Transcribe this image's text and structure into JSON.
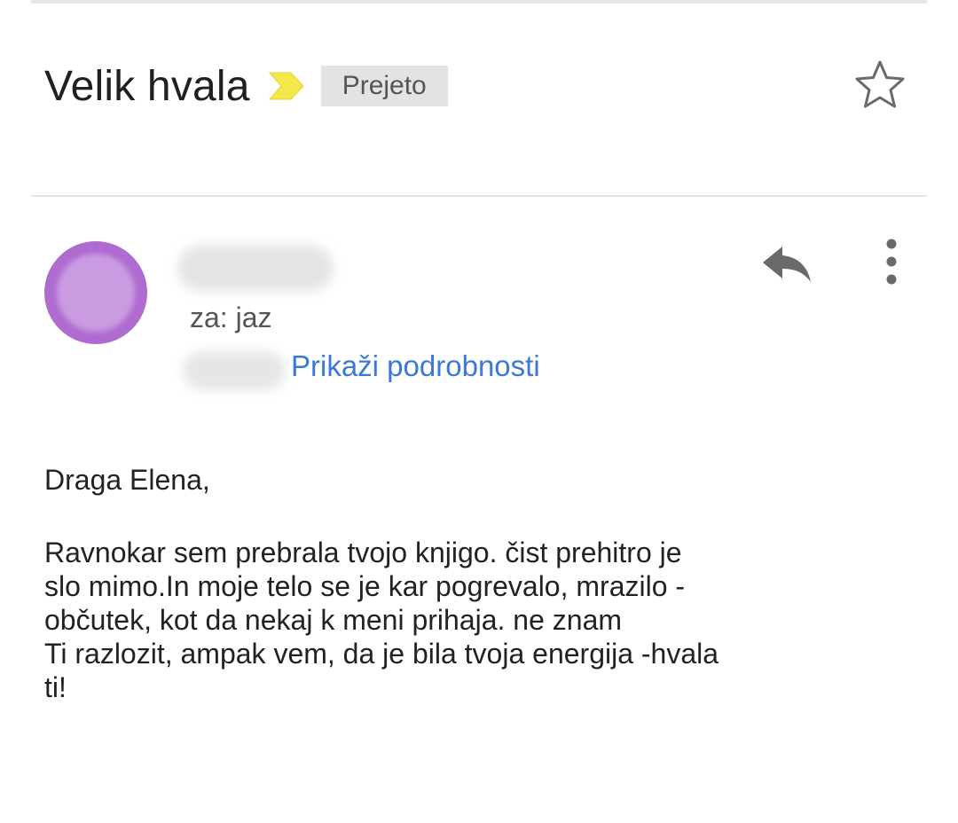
{
  "email": {
    "subject": "Velik hvala",
    "label": "Prejeto",
    "recipient": "za: jaz",
    "show_details": "Prikaži podrobnosti"
  },
  "body": {
    "greeting": "Draga Elena,",
    "lines": [
      "Ravnokar sem prebrala tvojo knjigo. čist prehitro je",
      "slo mimo.In moje telo se je kar pogrevalo, mrazilo -",
      "občutek, kot da nekaj k meni prihaja. ne znam",
      "Ti razlozit, ampak vem, da je bila tvoja energija -hvala",
      "ti!"
    ]
  },
  "icons": {
    "importance": "importance-marker-icon",
    "star": "star-outline-icon",
    "reply": "reply-icon",
    "more": "more-vertical-icon"
  },
  "colors": {
    "importance_marker": "#f2e84a",
    "avatar": "#b06bd1",
    "link": "#3b78d8",
    "label_chip": "#e3e3e3"
  }
}
